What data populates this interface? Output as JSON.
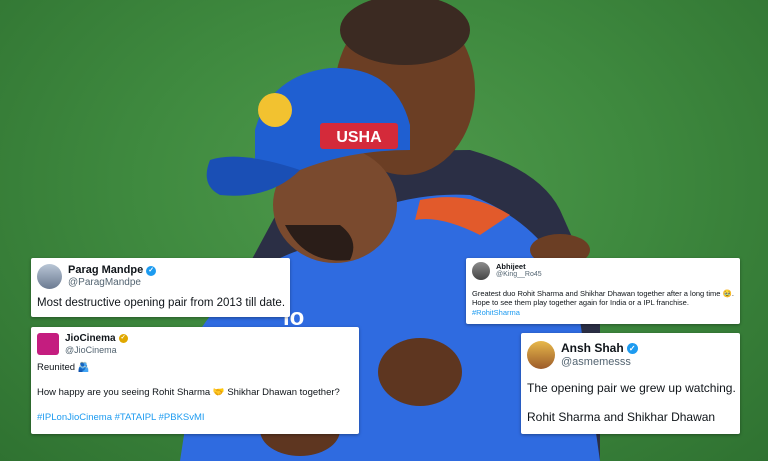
{
  "tweets": [
    {
      "name": "Parag Mandpe",
      "handle": "@ParagMandpe",
      "verified": "blue",
      "text": "Most destructive opening pair from 2013 till date."
    },
    {
      "name": "JioCinema",
      "handle": "@JioCinema",
      "verified": "gold",
      "line1": "Reunited 🫂",
      "line2": "How happy are you seeing Rohit Sharma  🤝  Shikhar Dhawan together?",
      "hashtags": "#IPLonJioCinema #TATAIPL #PBKSvMI"
    },
    {
      "name": "Abhijeet",
      "handle": "@King__Ro45",
      "text": "Greatest duo Rohit Sharma and Shikhar Dhawan together after a long time 🥹. Hope to see them play together again for India or a IPL franchise.",
      "hashtags": "#RohitSharma"
    },
    {
      "name": "Ansh Shah",
      "handle": "@asmemesss",
      "verified": "blue",
      "line1": "The opening pair we grew up watching.",
      "line2": "Rohit Sharma and Shikhar Dhawan"
    }
  ],
  "background": {
    "cap_text": "USHA",
    "jersey_text": "io"
  },
  "colors": {
    "pitch": "#3f8a3f",
    "cap": "#1f5fd1",
    "jersey": "#2f6be0",
    "link": "#1d9bf0"
  }
}
